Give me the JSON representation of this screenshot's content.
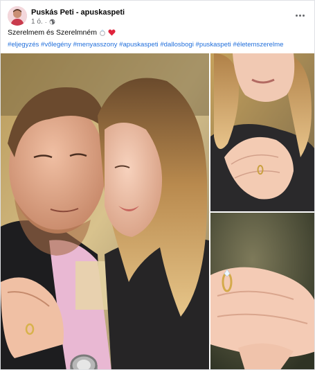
{
  "post": {
    "author": "Puskás Peti - apuskaspeti",
    "time": "1 ó.",
    "separator": "·",
    "privacy_icon": "globe-icon",
    "more_icon": "more-dots-icon",
    "caption": "Szerelmem és Szerelmném",
    "caption_emojis": [
      "ring-emoji",
      "red-heart-emoji"
    ],
    "hashtags": [
      "#eljegyzés",
      "#vőlegény",
      "#menyasszony",
      "#apuskaspeti",
      "#dallosbogi",
      "#puskaspeti",
      "#életemszerelme"
    ]
  },
  "photos": [
    {
      "name": "couple-embrace-photo"
    },
    {
      "name": "woman-ring-hand-photo"
    },
    {
      "name": "ring-closeup-photo"
    }
  ],
  "colors": {
    "link": "#216fdb",
    "text": "#050505",
    "secondary": "#65676b"
  }
}
